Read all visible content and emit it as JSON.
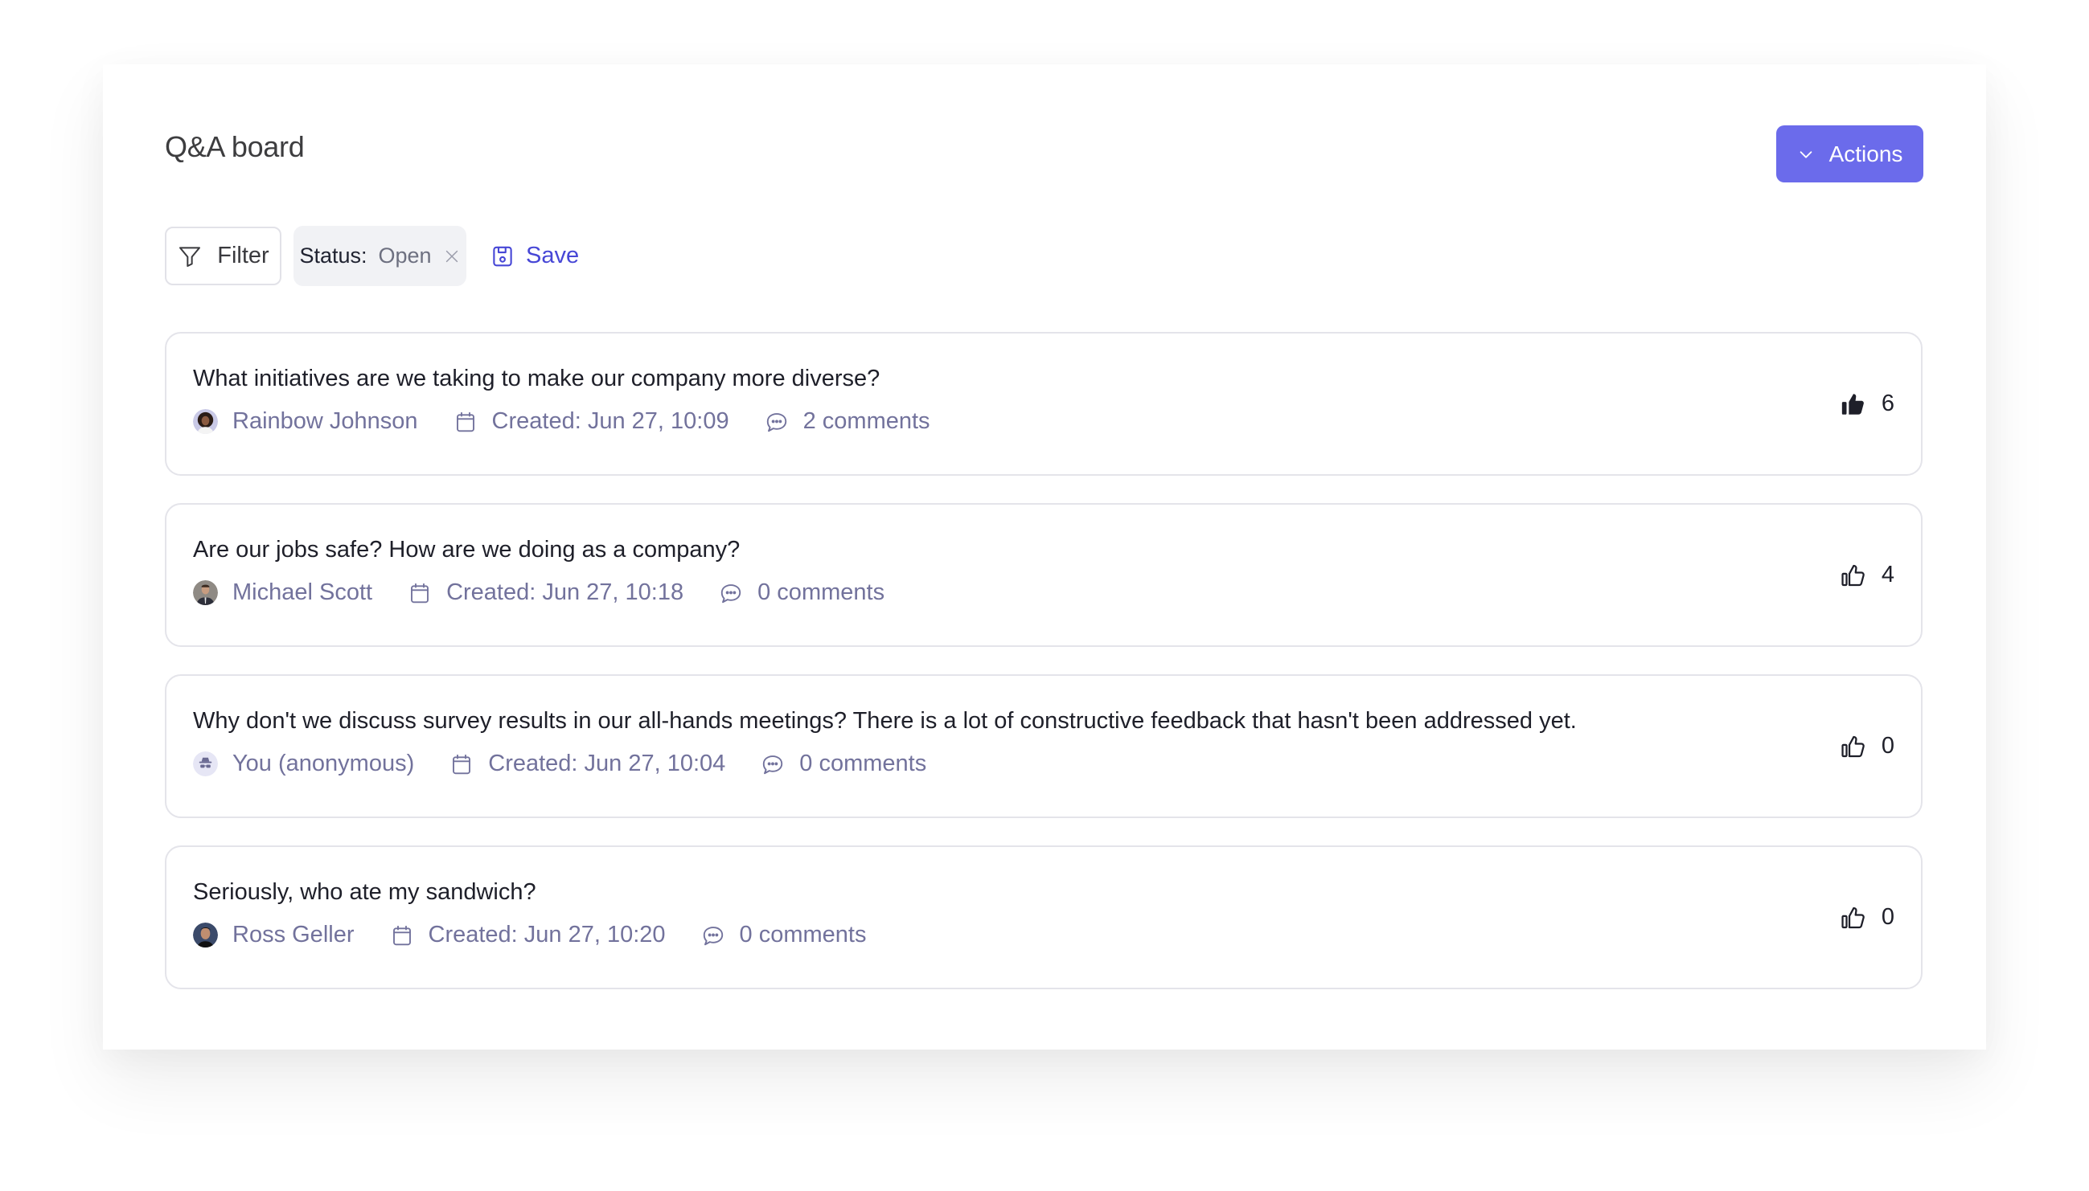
{
  "header": {
    "title": "Q&A board",
    "actions_label": "Actions",
    "actions_icon": "chevron-down-icon"
  },
  "colors": {
    "accent": "#6b6beb",
    "link": "#4747d6",
    "meta_text": "#72729c",
    "chip_bg": "#f1f2f5"
  },
  "toolbar": {
    "filter_label": "Filter",
    "filter_icon": "funnel-icon",
    "chip": {
      "key": "Status:",
      "value": "Open",
      "remove_icon": "close-icon"
    },
    "save_label": "Save",
    "save_icon": "floppy-disk-icon"
  },
  "questions": [
    {
      "text": "What initiatives are we taking to make our company more diverse?",
      "author": "Rainbow Johnson",
      "avatar": "photo-avatar",
      "created": "Created: Jun 27, 10:09",
      "comments": "2 comments",
      "votes": "6",
      "voted": true
    },
    {
      "text": "Are our jobs safe? How are we doing as a company?",
      "author": "Michael Scott",
      "avatar": "photo-avatar",
      "created": "Created: Jun 27, 10:18",
      "comments": "0 comments",
      "votes": "4",
      "voted": false
    },
    {
      "text": "Why don't we discuss survey results in our all-hands meetings? There is a lot of constructive feedback that hasn't been addressed yet.",
      "author": "You (anonymous)",
      "avatar": "anonymous-spy-avatar",
      "created": "Created: Jun 27, 10:04",
      "comments": "0 comments",
      "votes": "0",
      "voted": false
    },
    {
      "text": "Seriously, who ate my sandwich?",
      "author": "Ross Geller",
      "avatar": "photo-avatar",
      "created": "Created: Jun 27, 10:20",
      "comments": "0 comments",
      "votes": "0",
      "voted": false
    }
  ]
}
